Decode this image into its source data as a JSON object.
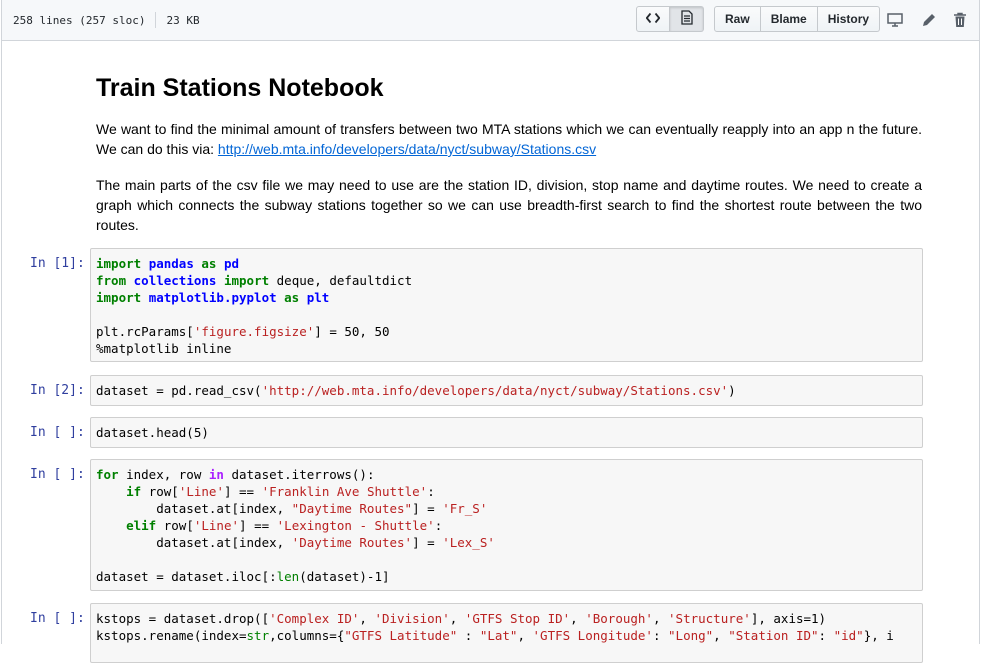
{
  "file_header": {
    "lines": "258 lines (257 sloc)",
    "size": "23 KB",
    "buttons": {
      "raw": "Raw",
      "blame": "Blame",
      "history": "History"
    }
  },
  "icons": {
    "code": "code-icon",
    "rendered": "file-rendered-icon",
    "desktop": "desktop-icon",
    "edit": "pencil-icon",
    "delete": "trash-icon"
  },
  "notebook": {
    "title": "Train Stations Notebook",
    "para1_text": "We want to find the minimal amount of transfers between two MTA stations which we can eventually reapply into an app n the future. We can do this via: ",
    "para1_link": "http://web.mta.info/developers/data/nyct/subway/Stations.csv",
    "para2": "The main parts of the csv file we may need to use are the station ID, division, stop name and daytime routes. We need to create a graph which connects the subway stations together so we can use breadth-first search to find the shortest route between the two routes.",
    "cells": [
      {
        "prompt": "In [1]:",
        "lines": [
          "import pandas as pd",
          "from collections import deque, defaultdict",
          "import matplotlib.pyplot as plt",
          "",
          "plt.rcParams['figure.figsize'] = 50, 50",
          "%matplotlib inline"
        ]
      },
      {
        "prompt": "In [2]:",
        "lines": [
          "dataset = pd.read_csv('http://web.mta.info/developers/data/nyct/subway/Stations.csv')"
        ]
      },
      {
        "prompt": "In [ ]:",
        "lines": [
          "dataset.head(5)"
        ]
      },
      {
        "prompt": "In [ ]:",
        "lines": [
          "for index, row in dataset.iterrows():",
          "    if row['Line'] == 'Franklin Ave Shuttle':",
          "        dataset.at[index, \"Daytime Routes\"] = 'Fr_S'",
          "    elif row['Line'] == 'Lexington - Shuttle':",
          "        dataset.at[index, 'Daytime Routes'] = 'Lex_S'",
          "",
          "dataset = dataset.iloc[:len(dataset)-1]"
        ]
      },
      {
        "prompt": "In [ ]:",
        "lines": [
          "kstops = dataset.drop(['Complex ID', 'Division', 'GTFS Stop ID', 'Borough', 'Structure'], axis=1)",
          "kstops.rename(index=str,columns={\"GTFS Latitude\" : \"Lat\", 'GTFS Longitude': \"Long\", \"Station ID\": \"id\"}, i"
        ]
      }
    ]
  }
}
